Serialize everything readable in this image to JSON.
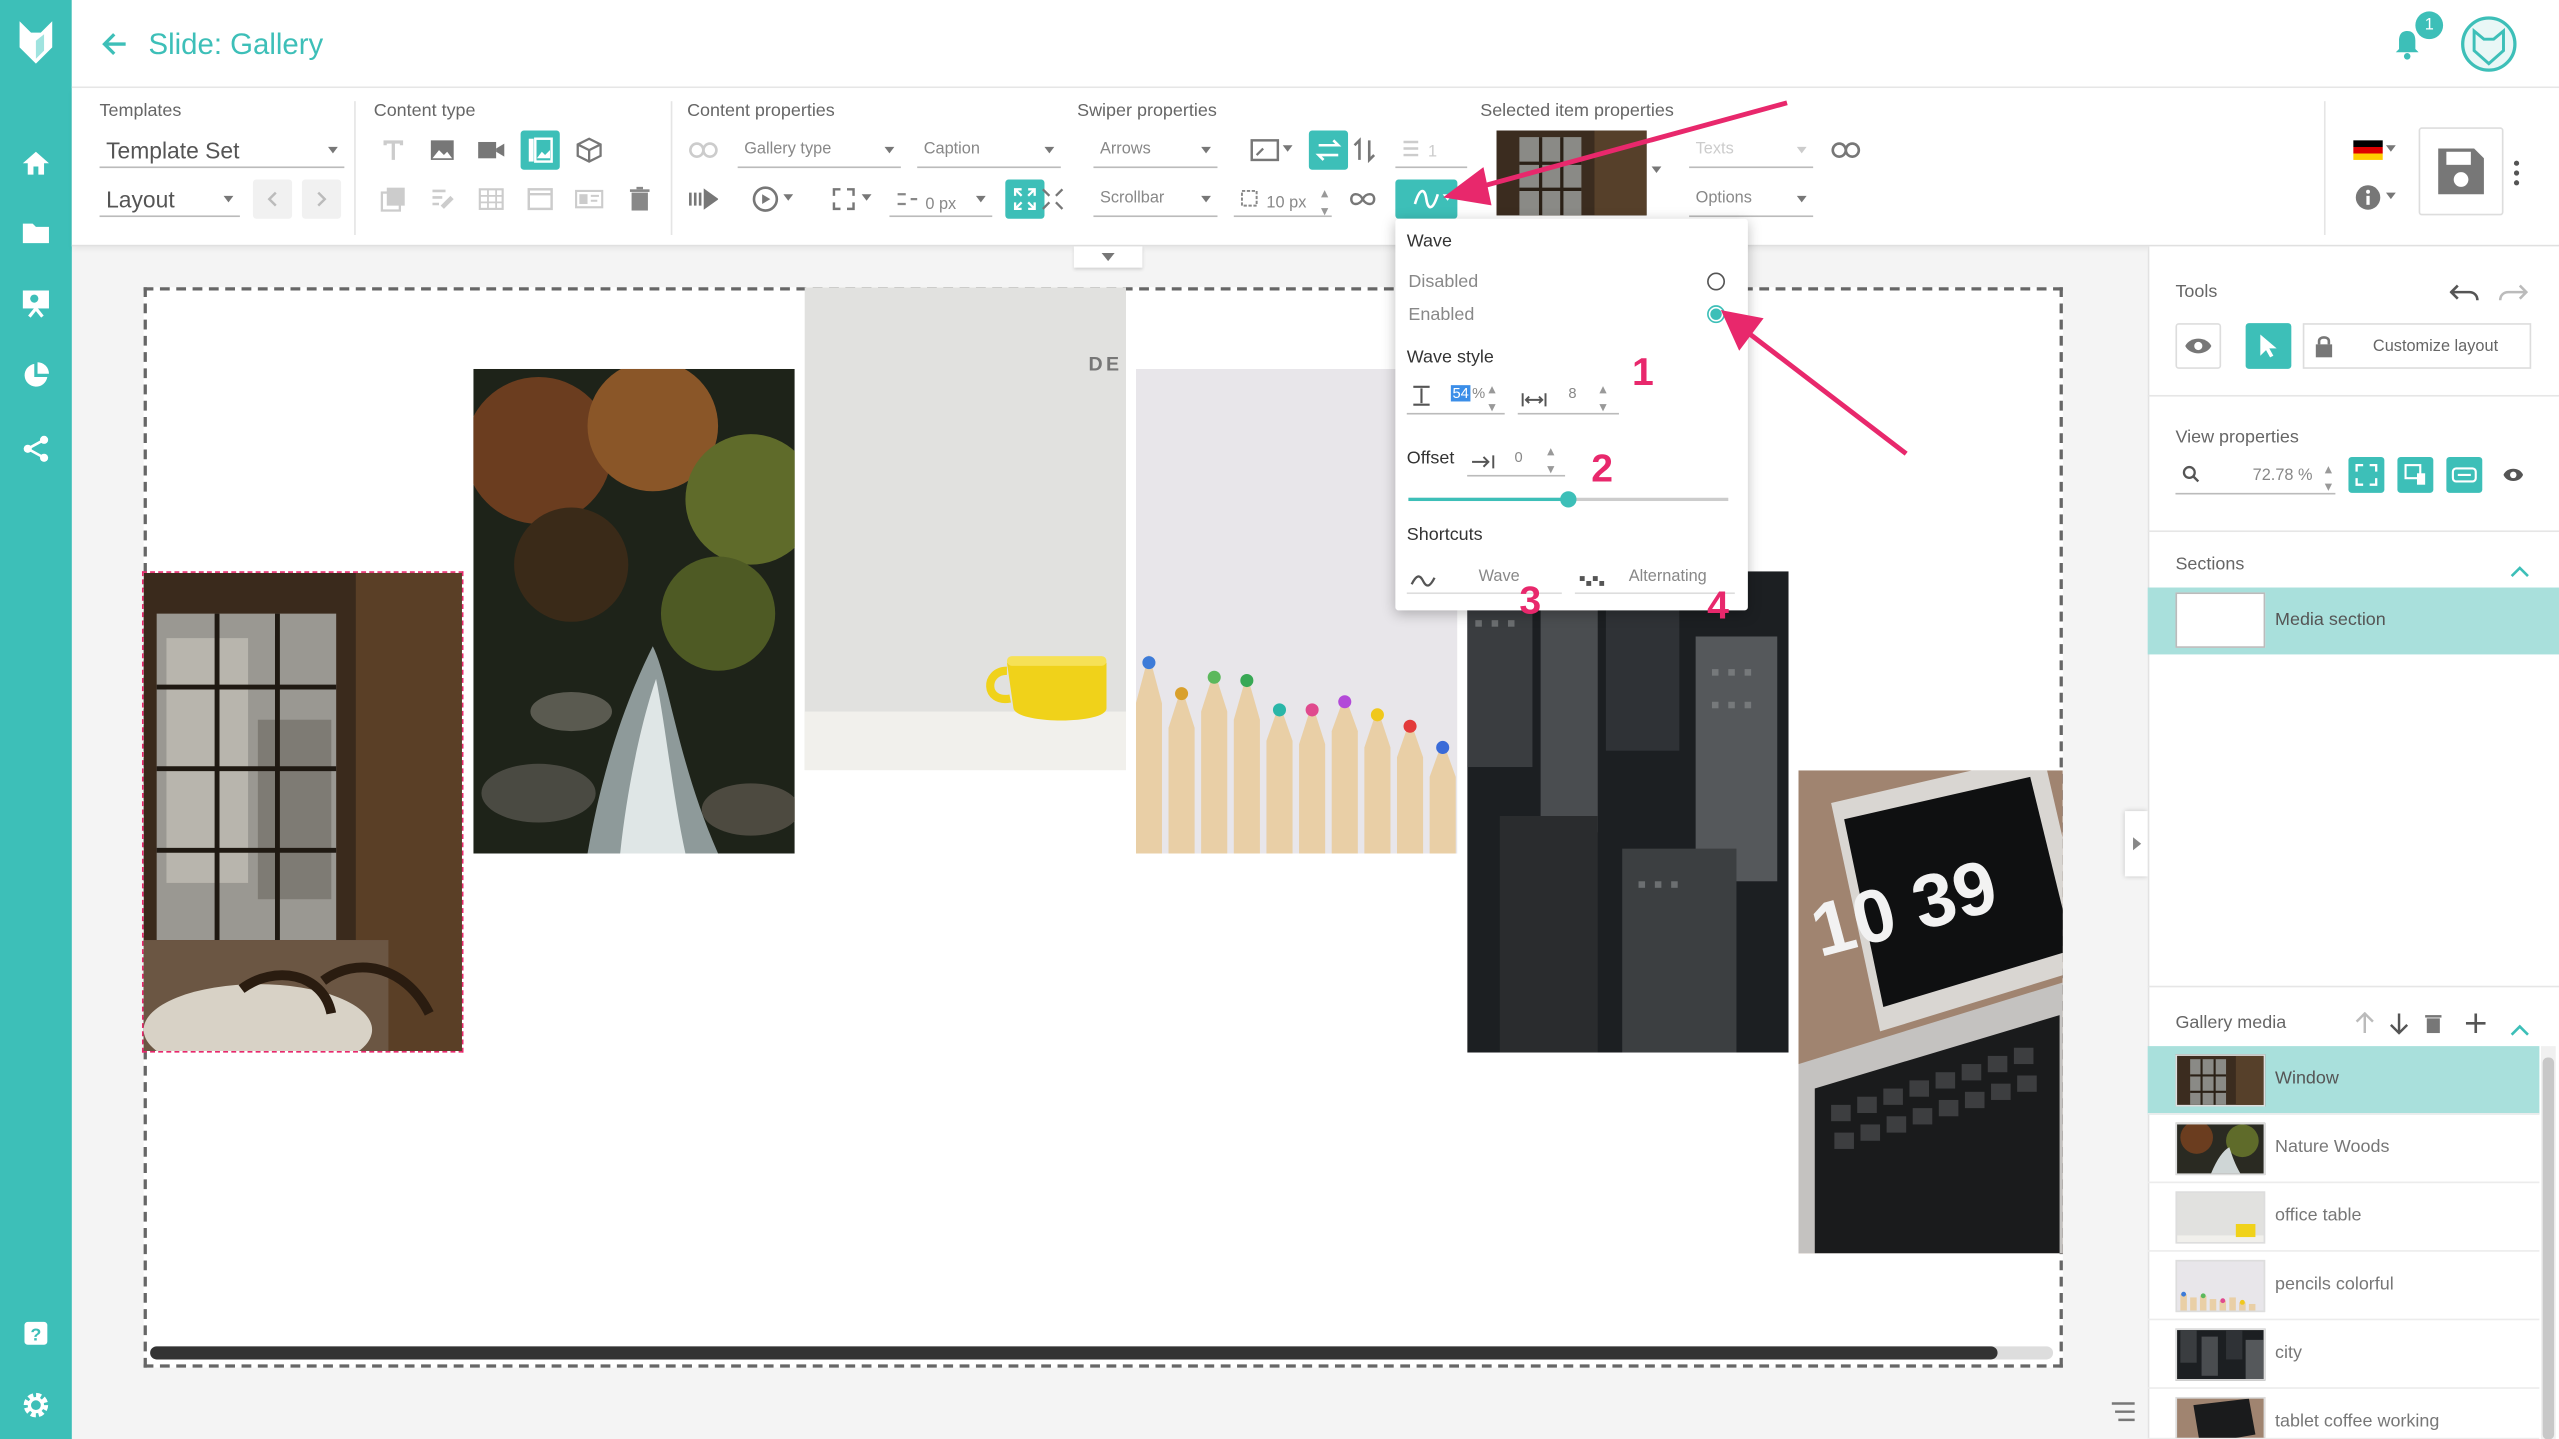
{
  "header": {
    "title": "Slide: Gallery",
    "notification_count": "1"
  },
  "toolbar": {
    "templates": {
      "label": "Templates",
      "template_set": "Template Set",
      "layout": "Layout"
    },
    "content_type": {
      "label": "Content type"
    },
    "content_properties": {
      "label": "Content properties",
      "gallery_type": "Gallery type",
      "caption": "Caption",
      "spacing": "0 px"
    },
    "swiper_properties": {
      "label": "Swiper properties",
      "arrows": "Arrows",
      "scrollbar": "Scrollbar",
      "border_value": "10",
      "border_unit": "px",
      "count_value": "1"
    },
    "selected_item": {
      "label": "Selected item properties",
      "texts": "Texts",
      "options": "Options"
    }
  },
  "wave_popup": {
    "title": "Wave",
    "disabled_label": "Disabled",
    "enabled_label": "Enabled",
    "selected": "Enabled",
    "wave_style_label": "Wave style",
    "height_value": "54",
    "height_unit": "%",
    "width_value": "8",
    "offset_label": "Offset",
    "offset_value": "0",
    "offset_slider_fraction": 0.5,
    "shortcuts_label": "Shortcuts",
    "shortcut_wave": "Wave",
    "shortcut_alternating": "Alternating"
  },
  "annotations": {
    "n1": "1",
    "n2": "2",
    "n3": "3",
    "n4": "4",
    "color": "#e8286c"
  },
  "right_panel": {
    "tools_label": "Tools",
    "customize_layout": "Customize layout",
    "view_properties_label": "View properties",
    "zoom": "72.78 %",
    "sections_label": "Sections",
    "section_item": "Media section",
    "gallery_media_label": "Gallery media",
    "media": [
      {
        "label": "Window"
      },
      {
        "label": "Nature Woods"
      },
      {
        "label": "office table"
      },
      {
        "label": "pencils colorful"
      },
      {
        "label": "city"
      },
      {
        "label": "tablet coffee working"
      }
    ]
  },
  "canvas": {
    "clock_text": "10 39",
    "office_text": "DE"
  },
  "colors": {
    "accent": "#3dbfb8",
    "highlight": "#e8286c"
  }
}
